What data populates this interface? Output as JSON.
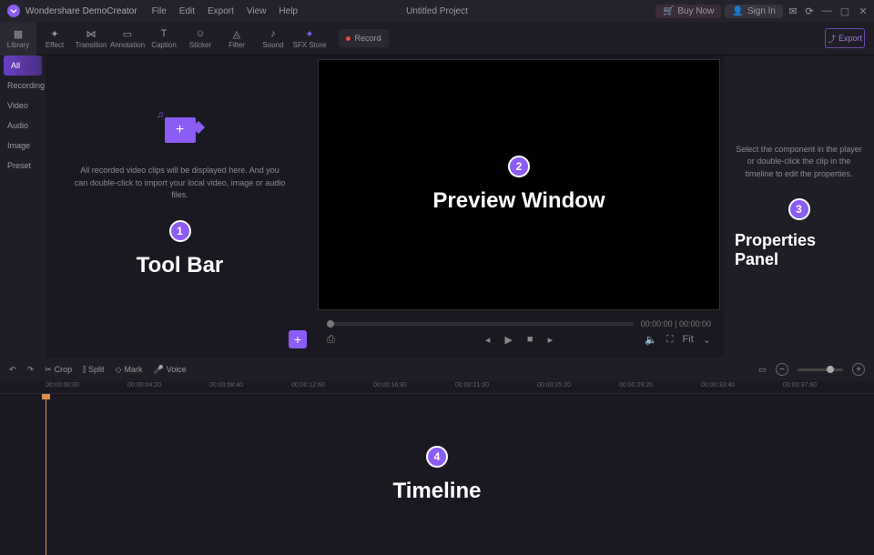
{
  "app": {
    "name": "Wondershare DemoCreator",
    "title": "Untitled Project"
  },
  "menu": {
    "file": "File",
    "edit": "Edit",
    "export": "Export",
    "view": "View",
    "help": "Help"
  },
  "titlebuttons": {
    "buy": "Buy Now",
    "signin": "Sign In"
  },
  "tools": {
    "library": "Library",
    "effect": "Effect",
    "transition": "Transition",
    "annotation": "Annotation",
    "caption": "Caption",
    "sticker": "Sticker",
    "filter": "Filter",
    "sound": "Sound",
    "sfx": "SFX Store",
    "record": "Record",
    "export": "Export"
  },
  "sidebar": {
    "all": "All",
    "recording": "Recording",
    "video": "Video",
    "audio": "Audio",
    "image": "Image",
    "preset": "Preset"
  },
  "library": {
    "hint": "All recorded video clips will be displayed here. And you can double-click to import your local video, image or audio files."
  },
  "annot": {
    "n1": "1",
    "t1": "Tool Bar",
    "n2": "2",
    "t2": "Preview Window",
    "n3": "3",
    "t3": "Properties Panel",
    "n4": "4",
    "t4": "Timeline"
  },
  "time": {
    "cur": "00:00:00",
    "dur": "00:00:00"
  },
  "props": {
    "hint": "Select the component in the player or double-click the clip in the timeline to edit the properties."
  },
  "timeline": {
    "undo": "↶",
    "redo": "↷",
    "crop": "Crop",
    "split": "Split",
    "mark": "Mark",
    "voice": "Voice",
    "fit": "Fit",
    "ticks": [
      "00:00:00:00",
      "00:00:04:20",
      "00:00:08:40",
      "00:00:12:60",
      "00:00:16:80",
      "00:00:21:00",
      "00:00:25:20",
      "00:00:29:20",
      "00:00:33:40",
      "00:00:37:60"
    ]
  }
}
